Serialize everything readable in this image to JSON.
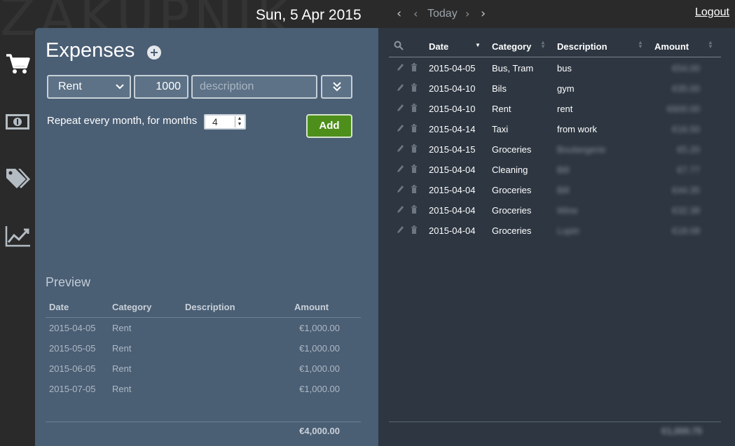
{
  "app": {
    "brand_text": "ZAKUPNIK"
  },
  "topbar": {
    "date": "Sun, 5 Apr 2015",
    "prev_fast": "‹",
    "prev": "‹",
    "today": "Today",
    "next": "›",
    "next_fast": "›",
    "logout": "Logout"
  },
  "rail": {
    "items": [
      {
        "icon": "cart-icon",
        "label": "Expenses"
      },
      {
        "icon": "money-icon",
        "label": "Income"
      },
      {
        "icon": "tags-icon",
        "label": "Categories"
      },
      {
        "icon": "chart-icon",
        "label": "Statistics"
      }
    ]
  },
  "form": {
    "title": "Expenses",
    "category_value": "Rent",
    "amount_value": "1000",
    "description_placeholder": "description",
    "repeat_label": "Repeat every month, for months",
    "months_value": "4",
    "add_label": "Add"
  },
  "preview": {
    "title": "Preview",
    "columns": {
      "date": "Date",
      "category": "Category",
      "description": "Description",
      "amount": "Amount"
    },
    "rows": [
      {
        "date": "2015-04-05",
        "category": "Rent",
        "description": "",
        "amount": "€1,000.00"
      },
      {
        "date": "2015-05-05",
        "category": "Rent",
        "description": "",
        "amount": "€1,000.00"
      },
      {
        "date": "2015-06-05",
        "category": "Rent",
        "description": "",
        "amount": "€1,000.00"
      },
      {
        "date": "2015-07-05",
        "category": "Rent",
        "description": "",
        "amount": "€1,000.00"
      }
    ],
    "total": "€4,000.00"
  },
  "list": {
    "columns": {
      "date": "Date",
      "category": "Category",
      "description": "Description",
      "amount": "Amount"
    },
    "rows": [
      {
        "date": "2015-04-05",
        "category": "Bus, Tram",
        "description": "bus",
        "amount": "€54.00",
        "desc_blurred": false
      },
      {
        "date": "2015-04-10",
        "category": "Bils",
        "description": "gym",
        "amount": "€35.00",
        "desc_blurred": false
      },
      {
        "date": "2015-04-10",
        "category": "Rent",
        "description": "rent",
        "amount": "€600.00",
        "desc_blurred": false
      },
      {
        "date": "2015-04-14",
        "category": "Taxi",
        "description": "from work",
        "amount": "€16.50",
        "desc_blurred": false
      },
      {
        "date": "2015-04-15",
        "category": "Groceries",
        "description": "Boulangerie",
        "amount": "€5.20",
        "desc_blurred": true
      },
      {
        "date": "2015-04-04",
        "category": "Cleaning",
        "description": "Bill",
        "amount": "€7.77",
        "desc_blurred": true
      },
      {
        "date": "2015-04-04",
        "category": "Groceries",
        "description": "Bill",
        "amount": "€44.35",
        "desc_blurred": true
      },
      {
        "date": "2015-04-04",
        "category": "Groceries",
        "description": "Wine",
        "amount": "€32.38",
        "desc_blurred": true
      },
      {
        "date": "2015-04-04",
        "category": "Groceries",
        "description": "Lupin",
        "amount": "€18.08",
        "desc_blurred": true
      }
    ],
    "total": "€1,000.75"
  },
  "colors": {
    "panel_left": "#4a5e74",
    "panel_right": "#2d3641",
    "accent_green": "#4d8f1a"
  }
}
